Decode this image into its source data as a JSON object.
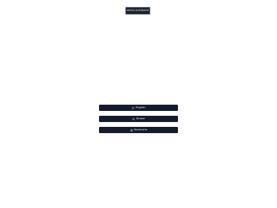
{
  "header": {
    "logo_text": "Media Database"
  },
  "actions": [
    {
      "label": "Register",
      "icon": "user-plus-icon"
    },
    {
      "label": "Browse",
      "icon": "search-icon"
    },
    {
      "label": "Bookmarks",
      "icon": "bookmark-icon"
    }
  ],
  "colors": {
    "background": "#ffffff",
    "button_bg": "#141b2d",
    "button_text": "#e5e7eb",
    "badge_border": "#6b7280"
  }
}
